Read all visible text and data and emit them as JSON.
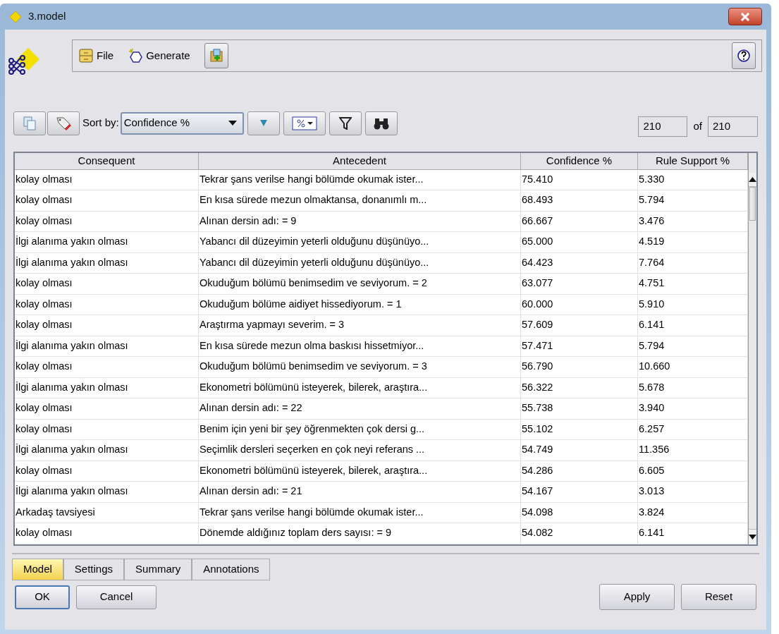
{
  "window": {
    "title": "3.model"
  },
  "menu": [
    {
      "label": "File",
      "kind": "file"
    },
    {
      "label": "Generate",
      "kind": "generate"
    }
  ],
  "toolbar": {
    "sort_label": "Sort by:",
    "sort_value": "Confidence %",
    "record_index": "210",
    "record_of": "of",
    "record_total": "210"
  },
  "table": {
    "columns": [
      "Consequent",
      "Antecedent",
      "Confidence %",
      "Rule Support %"
    ],
    "rows": [
      [
        "kolay olması",
        "Tekrar şans verilse hangi bölümde okumak ister...",
        "75.410",
        "5.330"
      ],
      [
        "kolay olması",
        "En kısa sürede mezun olmaktansa, donanımlı m...",
        "68.493",
        "5.794"
      ],
      [
        "kolay olması",
        "Alınan dersin adı: = 9",
        "66.667",
        "3.476"
      ],
      [
        "İlgi alanıma yakın olması",
        "Yabancı dil düzeyimin yeterli olduğunu düşünüyo...",
        "65.000",
        "4.519"
      ],
      [
        "İlgi alanıma yakın olması",
        "Yabancı dil düzeyimin yeterli olduğunu düşünüyo...",
        "64.423",
        "7.764"
      ],
      [
        "kolay olması",
        "Okuduğum bölümü benimsedim ve seviyorum. = 2",
        "63.077",
        "4.751"
      ],
      [
        "kolay olması",
        "Okuduğum bölüme aidiyet hissediyorum. = 1",
        "60.000",
        "5.910"
      ],
      [
        "kolay olması",
        "Araştırma yapmayı severim. = 3",
        "57.609",
        "6.141"
      ],
      [
        "İlgi alanıma yakın olması",
        "En kısa sürede mezun olma baskısı hissetmiyor...",
        "57.471",
        "5.794"
      ],
      [
        "kolay olması",
        "Okuduğum bölümü benimsedim ve seviyorum. = 3",
        "56.790",
        "10.660"
      ],
      [
        "İlgi alanıma yakın olması",
        "Ekonometri bölümünü isteyerek, bilerek, araştıra...",
        "56.322",
        "5.678"
      ],
      [
        "kolay olması",
        "Alınan dersin adı: = 22",
        "55.738",
        "3.940"
      ],
      [
        "kolay olması",
        "Benim için yeni bir şey öğrenmekten çok dersi g...",
        "55.102",
        "6.257"
      ],
      [
        "İlgi alanıma yakın olması",
        "Seçimlik dersleri seçerken en çok neyi referans ...",
        "54.749",
        "11.356"
      ],
      [
        "kolay olması",
        "Ekonometri bölümünü isteyerek, bilerek, araştıra...",
        "54.286",
        "6.605"
      ],
      [
        "İlgi alanıma yakın olması",
        "Alınan dersin adı: = 21",
        "54.167",
        "3.013"
      ],
      [
        "Arkadaş tavsiyesi",
        "Tekrar şans verilse hangi bölümde okumak ister...",
        "54.098",
        "3.824"
      ],
      [
        "kolay olması",
        "Dönemde aldığınız toplam ders sayısı: = 9",
        "54.082",
        "6.141"
      ]
    ]
  },
  "tabs": [
    {
      "label": "Model",
      "selected": true
    },
    {
      "label": "Settings",
      "selected": false
    },
    {
      "label": "Summary",
      "selected": false
    },
    {
      "label": "Annotations",
      "selected": false
    }
  ],
  "buttons_left": [
    {
      "label": "OK",
      "default": true
    },
    {
      "label": "Cancel",
      "default": false
    }
  ],
  "buttons_right": [
    "Apply",
    "Reset"
  ]
}
